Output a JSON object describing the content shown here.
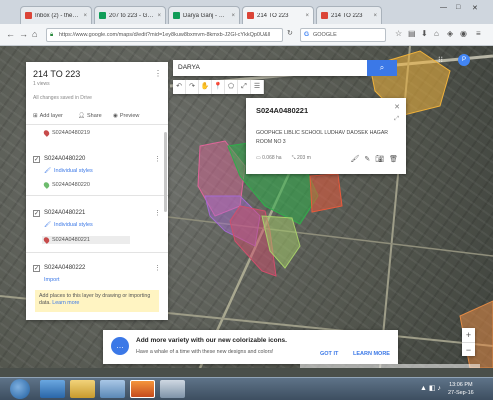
{
  "browser": {
    "tabs": [
      {
        "label": "Inbox (2) - thepro...",
        "color": "#db4437",
        "active": false
      },
      {
        "label": "207 to 223 - Googl...",
        "color": "#0f9d58",
        "active": false
      },
      {
        "label": "Darya Ganj - Goog...",
        "color": "#0f9d58",
        "active": false
      },
      {
        "label": "214 TO 223",
        "color": "#db4437",
        "active": true
      },
      {
        "label": "214 TO 223",
        "color": "#db4437",
        "active": false
      }
    ],
    "url": "https://www.google.com/maps/d/edit?mid=1ey8kuw8bxmvm-8kmxb-J2Gl-cYkkQp0U&ll",
    "search_engine_label": "G",
    "search_placeholder": "GOOGLE"
  },
  "panel": {
    "title": "214 TO 223",
    "meta": "1 views",
    "saved": "All changes saved in Drive",
    "actions": [
      {
        "icon": "add-layer-icon",
        "label": "Add layer"
      },
      {
        "icon": "share-icon",
        "label": "Share"
      },
      {
        "icon": "preview-icon",
        "label": "Preview"
      }
    ],
    "top_item": "S024A0480219",
    "layers": [
      {
        "name": "S024A0480220",
        "style": "Individual styles",
        "item": "S024A0480220",
        "item_color": "#6dbb6d"
      },
      {
        "name": "S024A0480221",
        "style": "Individual styles",
        "item": "S024A0480221",
        "item_color": "#c74b4b"
      },
      {
        "name": "S024A0480222",
        "style": "Import",
        "item": "",
        "item_color": ""
      }
    ],
    "hint_text": "Add places to this layer by drawing or importing data.",
    "hint_link": "Learn more"
  },
  "map": {
    "search_value": "DARYA",
    "search_button": "⌕",
    "tools": [
      "↶",
      "↷",
      "✋",
      "📍",
      "⬠",
      "⤢",
      "☰"
    ],
    "avatar": "P"
  },
  "card": {
    "title": "S024A0480221",
    "description": "GOOPHCE LIBLIC SCHOOL LUDHAV DAOSEK HAGAR ROOM NO 3",
    "area": "0.068 ha",
    "perimeter": "203 m",
    "icons": [
      "paint-icon",
      "edit-icon",
      "photo-icon",
      "delete-icon"
    ]
  },
  "promo": {
    "title": "Add more variety with our new colorizable icons.",
    "body": "Have a whale of a time with these new designs and colors!",
    "got_it": "GOT IT",
    "learn_more": "LEARN MORE"
  },
  "taskbar": {
    "time": "13:06 PM",
    "date": "27-Sep-16"
  }
}
